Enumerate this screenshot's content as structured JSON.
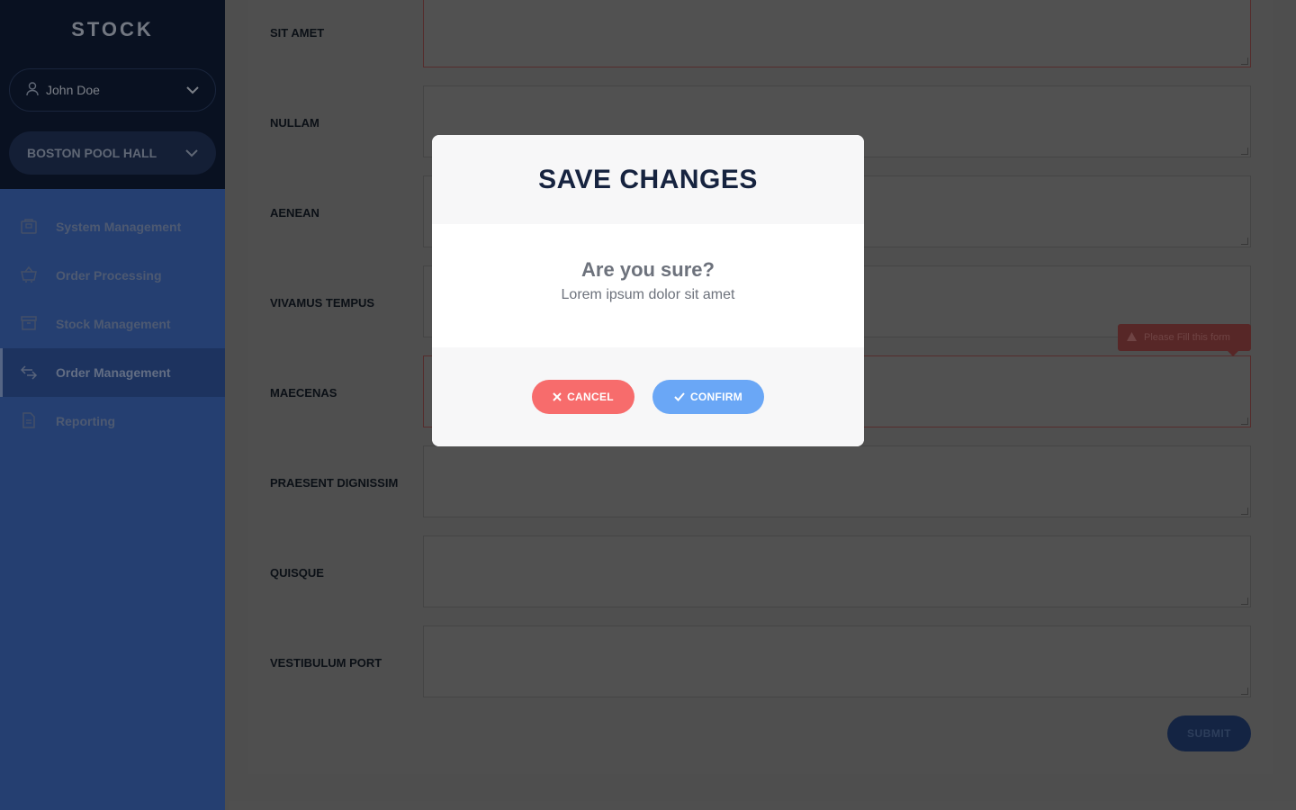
{
  "sidebar": {
    "brand": "STOCK",
    "user": "John Doe",
    "venue": "BOSTON POOL HALL",
    "items": [
      {
        "label": "System Management",
        "icon": "bag-icon"
      },
      {
        "label": "Order Processing",
        "icon": "basket-icon"
      },
      {
        "label": "Stock Management",
        "icon": "archive-box-icon"
      },
      {
        "label": "Order Management",
        "icon": "arrows-exchange-icon",
        "active": true
      },
      {
        "label": "Reporting",
        "icon": "document-icon"
      }
    ]
  },
  "form": {
    "fields": [
      "SIT AMET",
      "NULLAM",
      "AENEAN",
      "VIVAMUS TEMPUS",
      "MAECENAS",
      "PRAESENT DIGNISSIM",
      "QUISQUE",
      "VESTIBULUM PORT"
    ],
    "error_tooltip": "Please Fill this form",
    "submit_label": "SUBMIT"
  },
  "modal": {
    "title": "SAVE CHANGES",
    "question": "Are you sure?",
    "message": "Lorem ipsum dolor sit amet",
    "cancel_label": "CANCEL",
    "confirm_label": "CONFIRM"
  },
  "colors": {
    "sidebar_top": "#0f1c36",
    "sidebar": "#3c66b7",
    "cancel": "#f76c6c",
    "confirm": "#6aa7f6",
    "title": "#16233f"
  }
}
